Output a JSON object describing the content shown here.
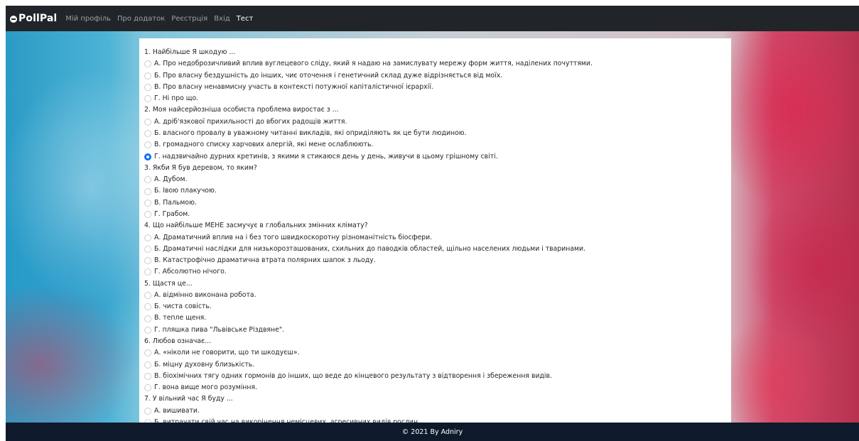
{
  "navbar": {
    "brand": "PollPal",
    "links": [
      {
        "label": "Мій профіль",
        "active": false
      },
      {
        "label": "Про додаток",
        "active": false
      },
      {
        "label": "Реєстрція",
        "active": false
      },
      {
        "label": "Вхід",
        "active": false
      },
      {
        "label": "Тест",
        "active": true
      }
    ]
  },
  "quiz": {
    "questions": [
      {
        "text": "1. Найбільше Я шкодую ...",
        "options": [
          {
            "label": "А. Про недоброзичливий вплив вуглецевого сліду, який я надаю на замислувату мережу форм життя, наділених почуттями.",
            "selected": false
          },
          {
            "label": "Б. Про власну бездушність до інших, чиє оточення і генетичний склад дуже відрізняється від моїх.",
            "selected": false
          },
          {
            "label": "В. Про власну ненавмисну участь в контексті потужної капіталістичної ієрархії.",
            "selected": false
          },
          {
            "label": "Г. Ні про що.",
            "selected": false
          }
        ]
      },
      {
        "text": "2. Моя найсерйозніша особиста проблема виростає з ...",
        "options": [
          {
            "label": "А. дріб'язкової прихильності до вбогих радощів життя.",
            "selected": false
          },
          {
            "label": "Б. власного провалу в уважному читанні викладів, які оприділяють як це бути людиною.",
            "selected": false
          },
          {
            "label": "В. громадного списку харчових алергій, які мене ослаблюють.",
            "selected": false
          },
          {
            "label": "Г. надзвичайно дурних кретинів, з якими я стикаюся день у день, живучи в цьому грішному світі.",
            "selected": true
          }
        ]
      },
      {
        "text": "3. Якби Я був деревом, то яким?",
        "options": [
          {
            "label": "А. Дубом.",
            "selected": false
          },
          {
            "label": "Б. Івою плакучою.",
            "selected": false
          },
          {
            "label": "В. Пальмою.",
            "selected": false
          },
          {
            "label": "Г. Грабом.",
            "selected": false
          }
        ]
      },
      {
        "text": "4. Що найбільше МЕНЕ засмучує в глобальних змінних клімату?",
        "options": [
          {
            "label": "А. Драматичний вплив на і без того швидкоскоротну різноманітність біосфери.",
            "selected": false
          },
          {
            "label": "Б. Драматичні наслідки для низькорозташованих, схильних до паводків областей, щільно населених людьми і тваринами.",
            "selected": false
          },
          {
            "label": "В. Катастрофічно драматична втрата полярних шапок з льоду.",
            "selected": false
          },
          {
            "label": "Г. Абсолютно нічого.",
            "selected": false
          }
        ]
      },
      {
        "text": "5. Щастя це...",
        "options": [
          {
            "label": "А. відмінно виконана робота.",
            "selected": false
          },
          {
            "label": "Б. чиста совість.",
            "selected": false
          },
          {
            "label": "В. тепле щеня.",
            "selected": false
          },
          {
            "label": "Г. пляшка пива \"Львівське Різдвяне\".",
            "selected": false
          }
        ]
      },
      {
        "text": "6. Любов означає...",
        "options": [
          {
            "label": "А. «ніколи не говорити, що ти шкодуєш».",
            "selected": false
          },
          {
            "label": "Б. міцну духовну близькість.",
            "selected": false
          },
          {
            "label": "В. біохімічних тягу одних гормонів до інших, що веде до кінцевого результату з відтворення і збереження видів.",
            "selected": false
          },
          {
            "label": "Г. вона вище мого розуміння.",
            "selected": false
          }
        ]
      },
      {
        "text": "7. У вільний час Я буду ...",
        "options": [
          {
            "label": "А. вишивати.",
            "selected": false
          },
          {
            "label": "Б. витрачати свій час на викорінення немісцевих, агресивних видів рослин.",
            "selected": false
          }
        ]
      }
    ]
  },
  "footer": {
    "text": "© 2021 By Adniry"
  },
  "colors": {
    "navbar": "#212529",
    "footer": "#0e1a2b",
    "accent": "#0d6efd"
  }
}
